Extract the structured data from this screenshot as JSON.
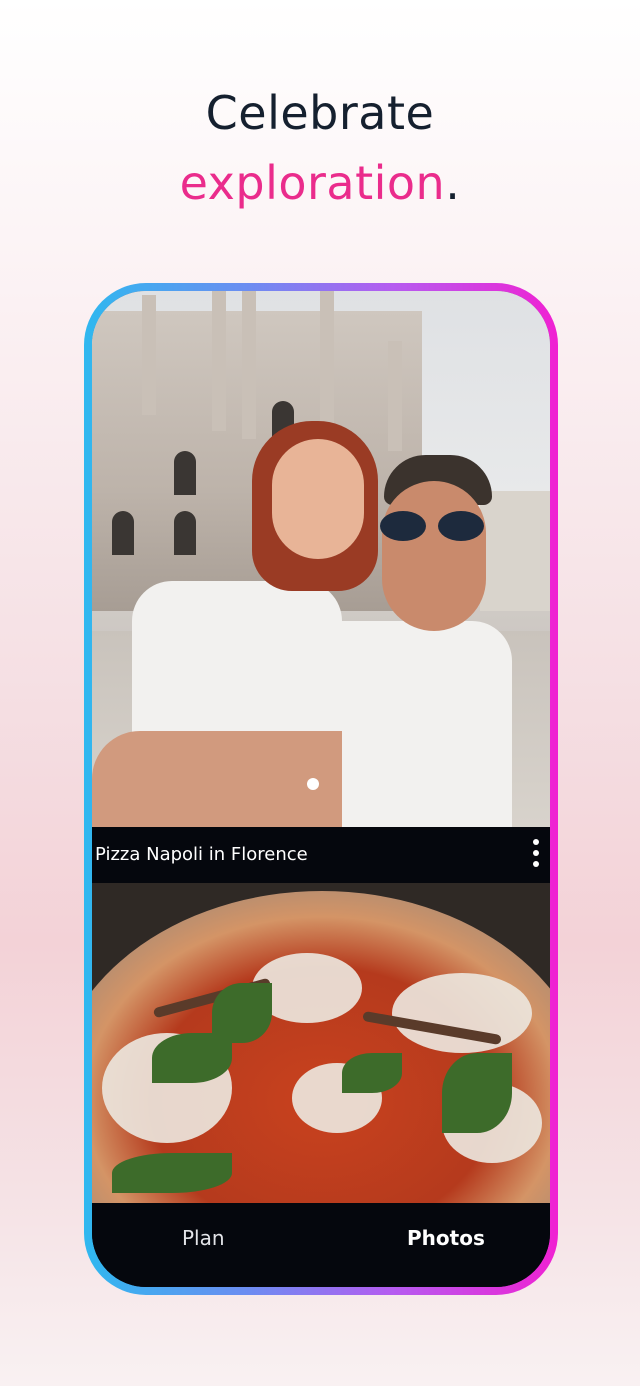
{
  "headline": {
    "line1": "Celebrate",
    "line2_accent": "exploration",
    "line2_punct": "."
  },
  "colors": {
    "accent": "#ea2c8c",
    "headline_text": "#15202f",
    "frame_gradient": [
      "#2fb8ef",
      "#b55cf0",
      "#f021d2"
    ]
  },
  "feed": {
    "caption": "Pizza Napoli in Florence",
    "more_icon": "more-vertical-icon"
  },
  "bottom_nav": {
    "tabs": [
      {
        "label": "Plan",
        "active": false
      },
      {
        "label": "Photos",
        "active": true
      }
    ]
  }
}
